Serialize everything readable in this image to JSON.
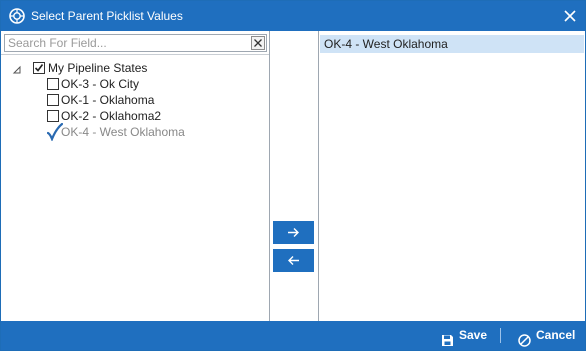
{
  "window": {
    "title": "Select Parent Picklist Values"
  },
  "search": {
    "placeholder": "Search For Field...",
    "value": ""
  },
  "tree": {
    "root": {
      "label": "My Pipeline States",
      "checked": true,
      "expanded": true
    },
    "items": [
      {
        "label": "OK-3 - Ok City",
        "checked": false,
        "selected": false
      },
      {
        "label": "OK-1 - Oklahoma",
        "checked": false,
        "selected": false
      },
      {
        "label": "OK-2 - Oklahoma2",
        "checked": false,
        "selected": false
      },
      {
        "label": "OK-4 - West Oklahoma",
        "checked": true,
        "selected": true
      }
    ]
  },
  "selected_values": [
    {
      "label": "OK-4 - West Oklahoma"
    }
  ],
  "buttons": {
    "move_right_icon": "arrow-right-icon",
    "move_left_icon": "arrow-left-icon",
    "save_label": "Save",
    "cancel_label": "Cancel"
  },
  "colors": {
    "accent": "#1f6fbf",
    "selection": "#cfe3f6",
    "check_blue": "#2a6ab1"
  }
}
